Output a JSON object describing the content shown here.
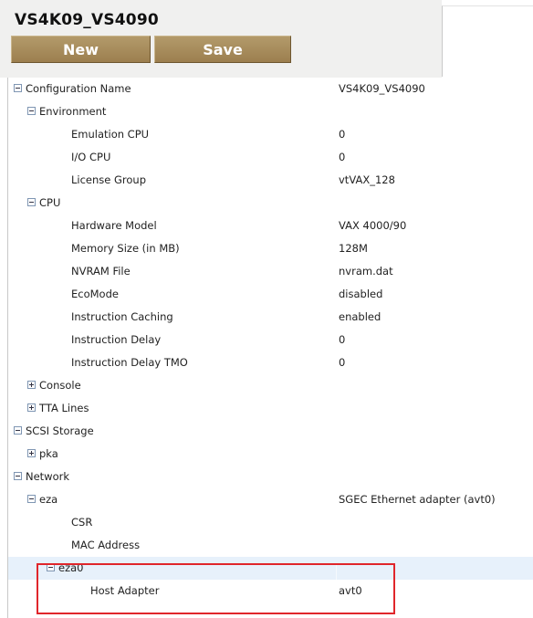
{
  "header": {
    "config_title": "VS4K09_VS4090",
    "new_label": "New",
    "save_label": "Save"
  },
  "tree": {
    "rows": [
      {
        "label": "Configuration Name",
        "value": "VS4K09_VS4090",
        "toggle": "minus"
      },
      {
        "label": "Environment",
        "value": "",
        "toggle": "minus"
      },
      {
        "label": "Emulation CPU",
        "value": "0",
        "toggle": ""
      },
      {
        "label": "I/O CPU",
        "value": "0",
        "toggle": ""
      },
      {
        "label": "License Group",
        "value": "vtVAX_128",
        "toggle": ""
      },
      {
        "label": "CPU",
        "value": "",
        "toggle": "minus"
      },
      {
        "label": "Hardware Model",
        "value": "VAX 4000/90",
        "toggle": ""
      },
      {
        "label": "Memory Size (in MB)",
        "value": "128M",
        "toggle": ""
      },
      {
        "label": "NVRAM File",
        "value": "nvram.dat",
        "toggle": ""
      },
      {
        "label": "EcoMode",
        "value": "disabled",
        "toggle": ""
      },
      {
        "label": "Instruction Caching",
        "value": "enabled",
        "toggle": ""
      },
      {
        "label": "Instruction Delay",
        "value": "0",
        "toggle": ""
      },
      {
        "label": "Instruction Delay TMO",
        "value": "0",
        "toggle": ""
      },
      {
        "label": "Console",
        "value": "",
        "toggle": "plus"
      },
      {
        "label": "TTA Lines",
        "value": "",
        "toggle": "plus"
      },
      {
        "label": "SCSI Storage",
        "value": "",
        "toggle": "minus"
      },
      {
        "label": "pka",
        "value": "",
        "toggle": "plus"
      },
      {
        "label": "Network",
        "value": "",
        "toggle": "minus"
      },
      {
        "label": "eza",
        "value": "SGEC Ethernet adapter (avt0)",
        "toggle": "minus"
      },
      {
        "label": "CSR",
        "value": "",
        "toggle": ""
      },
      {
        "label": "MAC Address",
        "value": "",
        "toggle": ""
      },
      {
        "label": "eza0",
        "value": "",
        "toggle": "minus"
      },
      {
        "label": "Host Adapter",
        "value": "avt0",
        "toggle": ""
      }
    ]
  },
  "colors": {
    "button_bg": "#a68a5a",
    "highlight_row": "#e7f1fb",
    "callout_border": "#e0262b"
  }
}
